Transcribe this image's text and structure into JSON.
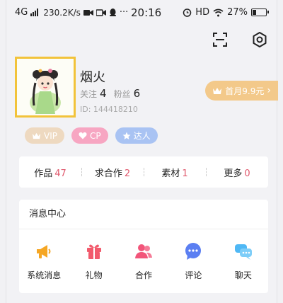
{
  "status_bar": {
    "network": "4G",
    "speed": "230.2K/s",
    "dots": "···",
    "time": "20:16",
    "hd": "HD",
    "battery_pct": "27%",
    "battery_level": 0.27
  },
  "profile": {
    "name": "烟火",
    "following_label": "关注",
    "following": "4",
    "fans_label": "粉丝",
    "fans": "6",
    "id_text": "ID: 144418210"
  },
  "promo": {
    "label": "首月9.9元",
    "arrow": "›"
  },
  "badges": [
    {
      "label": "VIP",
      "color": "#eed9c0",
      "icon": "crown-icon"
    },
    {
      "label": "CP",
      "color": "#f7a6c2",
      "icon": "heart-icon"
    },
    {
      "label": "达人",
      "color": "#a9c3f3",
      "icon": "star-icon"
    }
  ],
  "tabs": [
    {
      "label": "作品",
      "count": "47"
    },
    {
      "label": "求合作",
      "count": "2"
    },
    {
      "label": "素材",
      "count": "1"
    },
    {
      "label": "更多",
      "count": "0"
    }
  ],
  "messages": {
    "title": "消息中心",
    "items": [
      {
        "label": "系统消息",
        "icon": "megaphone-icon",
        "color": "#f5a623"
      },
      {
        "label": "礼物",
        "icon": "gift-icon",
        "color": "#f25a6c"
      },
      {
        "label": "合作",
        "icon": "people-icon",
        "color": "#f2557a"
      },
      {
        "label": "评论",
        "icon": "comment-icon",
        "color": "#5b7ff2"
      },
      {
        "label": "聊天",
        "icon": "chat-icon",
        "color": "#4fb8f5"
      }
    ]
  }
}
